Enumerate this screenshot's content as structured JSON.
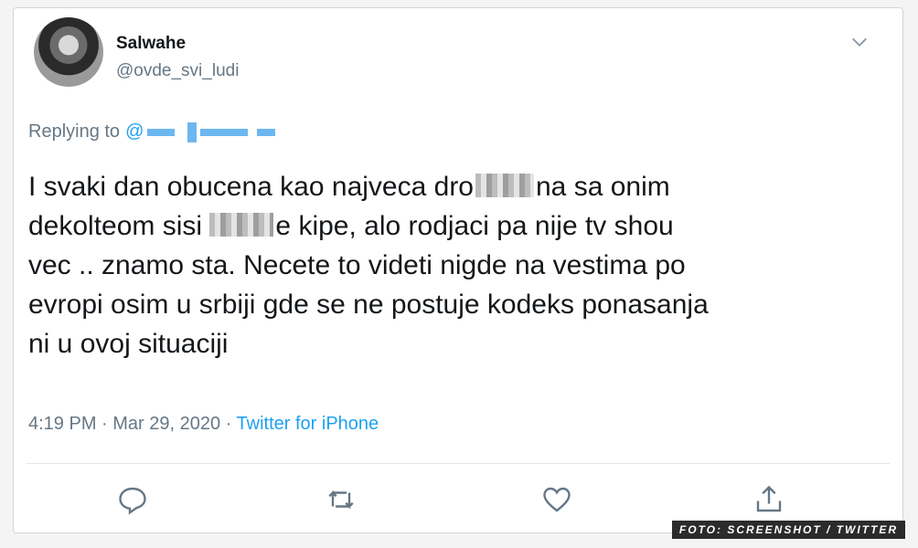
{
  "tweet": {
    "display_name": "Salwahe",
    "handle": "@ovde_svi_ludi",
    "replying_prefix": "Replying to",
    "replying_handle_start": "@",
    "text_lines": {
      "l1a": "I svaki dan obucena kao najveca dro",
      "l1b": "na sa onim",
      "l2a": "dekolteom sisi",
      "l2b": "e kipe, alo rodjaci pa nije tv shou",
      "l3": "vec .. znamo sta. Necete to videti nigde na vestima po",
      "l4": "evropi osim u srbiji gde se ne postuje kodeks ponasanja",
      "l5": "ni u ovoj situaciji"
    },
    "time": "4:19 PM",
    "separator1": " · ",
    "date": "Mar 29, 2020",
    "separator2": " · ",
    "source": "Twitter for iPhone"
  },
  "icons": {
    "more": "chevron-down-icon",
    "reply": "reply-icon",
    "retweet": "retweet-icon",
    "like": "heart-icon",
    "share": "share-icon"
  },
  "colors": {
    "link": "#1da1f2",
    "muted": "#657786",
    "text": "#14171a"
  },
  "watermark": "FOTO: SCREENSHOT / TWITTER"
}
